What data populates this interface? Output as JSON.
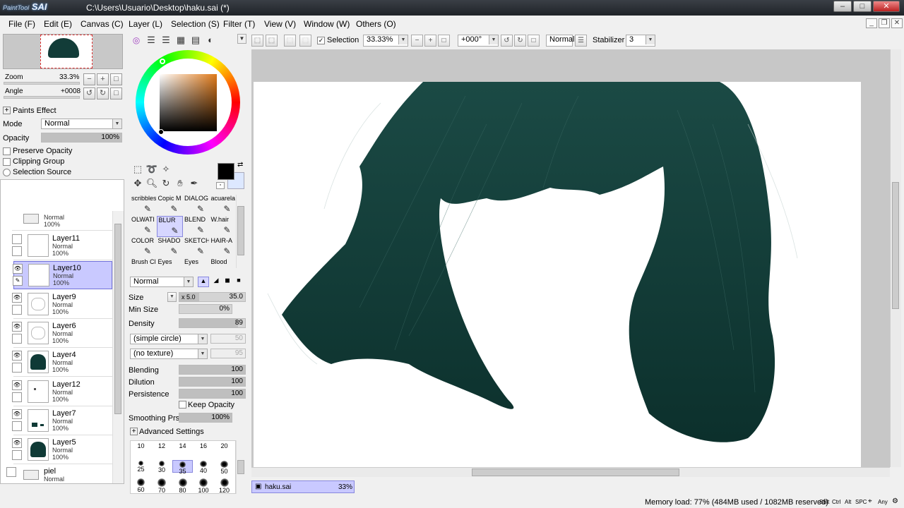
{
  "window": {
    "app_logo_small": "PaintTool",
    "app_logo": "SAI",
    "title": "C:\\Users\\Usuario\\Desktop\\haku.sai (*)"
  },
  "menu": [
    "File (F)",
    "Edit (E)",
    "Canvas (C)",
    "Layer (L)",
    "Selection (S)",
    "Filter (T)",
    "View (V)",
    "Window (W)",
    "Others (O)"
  ],
  "navigator": {
    "zoom_label": "Zoom",
    "zoom_value": "33.3%",
    "angle_label": "Angle",
    "angle_value": "+0008"
  },
  "paints": {
    "header": "Paints Effect",
    "mode_label": "Mode",
    "mode_value": "Normal",
    "opacity_label": "Opacity",
    "opacity_value": "100%",
    "opacity_level": 1.0,
    "checks": [
      "Preserve Opacity",
      "Clipping Group"
    ],
    "radio": "Selection Source"
  },
  "layers": [
    {
      "name": "Layer11",
      "mode": "Normal",
      "opacity": "100%",
      "visible": false,
      "selected": false,
      "thumb": "blank"
    },
    {
      "name": "Layer10",
      "mode": "Normal",
      "opacity": "100%",
      "visible": true,
      "selected": true,
      "thumb": "blank"
    },
    {
      "name": "Layer9",
      "mode": "Normal",
      "opacity": "100%",
      "visible": true,
      "selected": false,
      "thumb": "sketch"
    },
    {
      "name": "Layer6",
      "mode": "Normal",
      "opacity": "100%",
      "visible": true,
      "selected": false,
      "thumb": "sketch"
    },
    {
      "name": "Layer4",
      "mode": "Normal",
      "opacity": "100%",
      "visible": true,
      "selected": false,
      "thumb": "hair"
    },
    {
      "name": "Layer12",
      "mode": "Normal",
      "opacity": "100%",
      "visible": true,
      "selected": false,
      "thumb": "dot"
    },
    {
      "name": "Layer7",
      "mode": "Normal",
      "opacity": "100%",
      "visible": true,
      "selected": false,
      "thumb": "bits"
    },
    {
      "name": "Layer5",
      "mode": "Normal",
      "opacity": "100%",
      "visible": true,
      "selected": false,
      "thumb": "hair"
    }
  ],
  "top_folder": {
    "mode": "Normal",
    "opacity": "100%"
  },
  "bottom_folder": {
    "name": "piel",
    "mode": "Normal"
  },
  "brushes": [
    {
      "name": "scribbles",
      "selected": false
    },
    {
      "name": "Copic M",
      "selected": false
    },
    {
      "name": "DIALOG",
      "selected": false
    },
    {
      "name": "acuarela",
      "selected": false
    },
    {
      "name": "OLWATI",
      "selected": false
    },
    {
      "name": "BLUR",
      "selected": true
    },
    {
      "name": "BLEND",
      "selected": false
    },
    {
      "name": "W.hair",
      "selected": false
    },
    {
      "name": "COLOR",
      "selected": false
    },
    {
      "name": "SHADO",
      "selected": false
    },
    {
      "name": "SKETCH",
      "selected": false
    },
    {
      "name": "HAIR-A",
      "selected": false
    },
    {
      "name": "Brush Cl",
      "selected": false
    },
    {
      "name": "Eyes",
      "selected": false
    },
    {
      "name": "Eyes",
      "selected": false
    },
    {
      "name": "Blood",
      "selected": false
    }
  ],
  "brush_settings": {
    "blend_mode": "Normal",
    "size_label": "Size",
    "size_mult": "x 5.0",
    "size_value": "35.0",
    "min_size_label": "Min Size",
    "min_size_value": "0%",
    "density_label": "Density",
    "density_value": "89",
    "shape": "(simple circle)",
    "shape_val": "50",
    "texture": "(no texture)",
    "texture_val": "95",
    "blending_label": "Blending",
    "blending_value": "100",
    "dilution_label": "Dilution",
    "dilution_value": "100",
    "persistence_label": "Persistence",
    "persistence_value": "100",
    "keep_opacity": "Keep Opacity",
    "smoothing_label": "Smoothing Prs",
    "smoothing_value": "100%",
    "advanced": "Advanced Settings"
  },
  "brush_sizes": [
    "10",
    "12",
    "14",
    "16",
    "20",
    "25",
    "30",
    "35",
    "40",
    "50",
    "60",
    "70",
    "80",
    "100",
    "120"
  ],
  "toolbar": {
    "selection_label": "Selection",
    "zoom": "33.33%",
    "angle": "+000°",
    "blend": "Normal",
    "stabilizer_label": "Stabilizer",
    "stabilizer_value": "3"
  },
  "document_tab": {
    "name": "haku.sai",
    "zoom": "33%"
  },
  "status": {
    "memory": "Memory load: 77% (484MB used / 1082MB reserved)",
    "keys": [
      "Shft",
      "Ctrl",
      "Alt",
      "SPC"
    ],
    "any": "Any"
  },
  "colors": {
    "hair": "#0f3a36",
    "selection": "#c9c9ff",
    "primary": "#000000",
    "secondary": "#dde8ff"
  }
}
